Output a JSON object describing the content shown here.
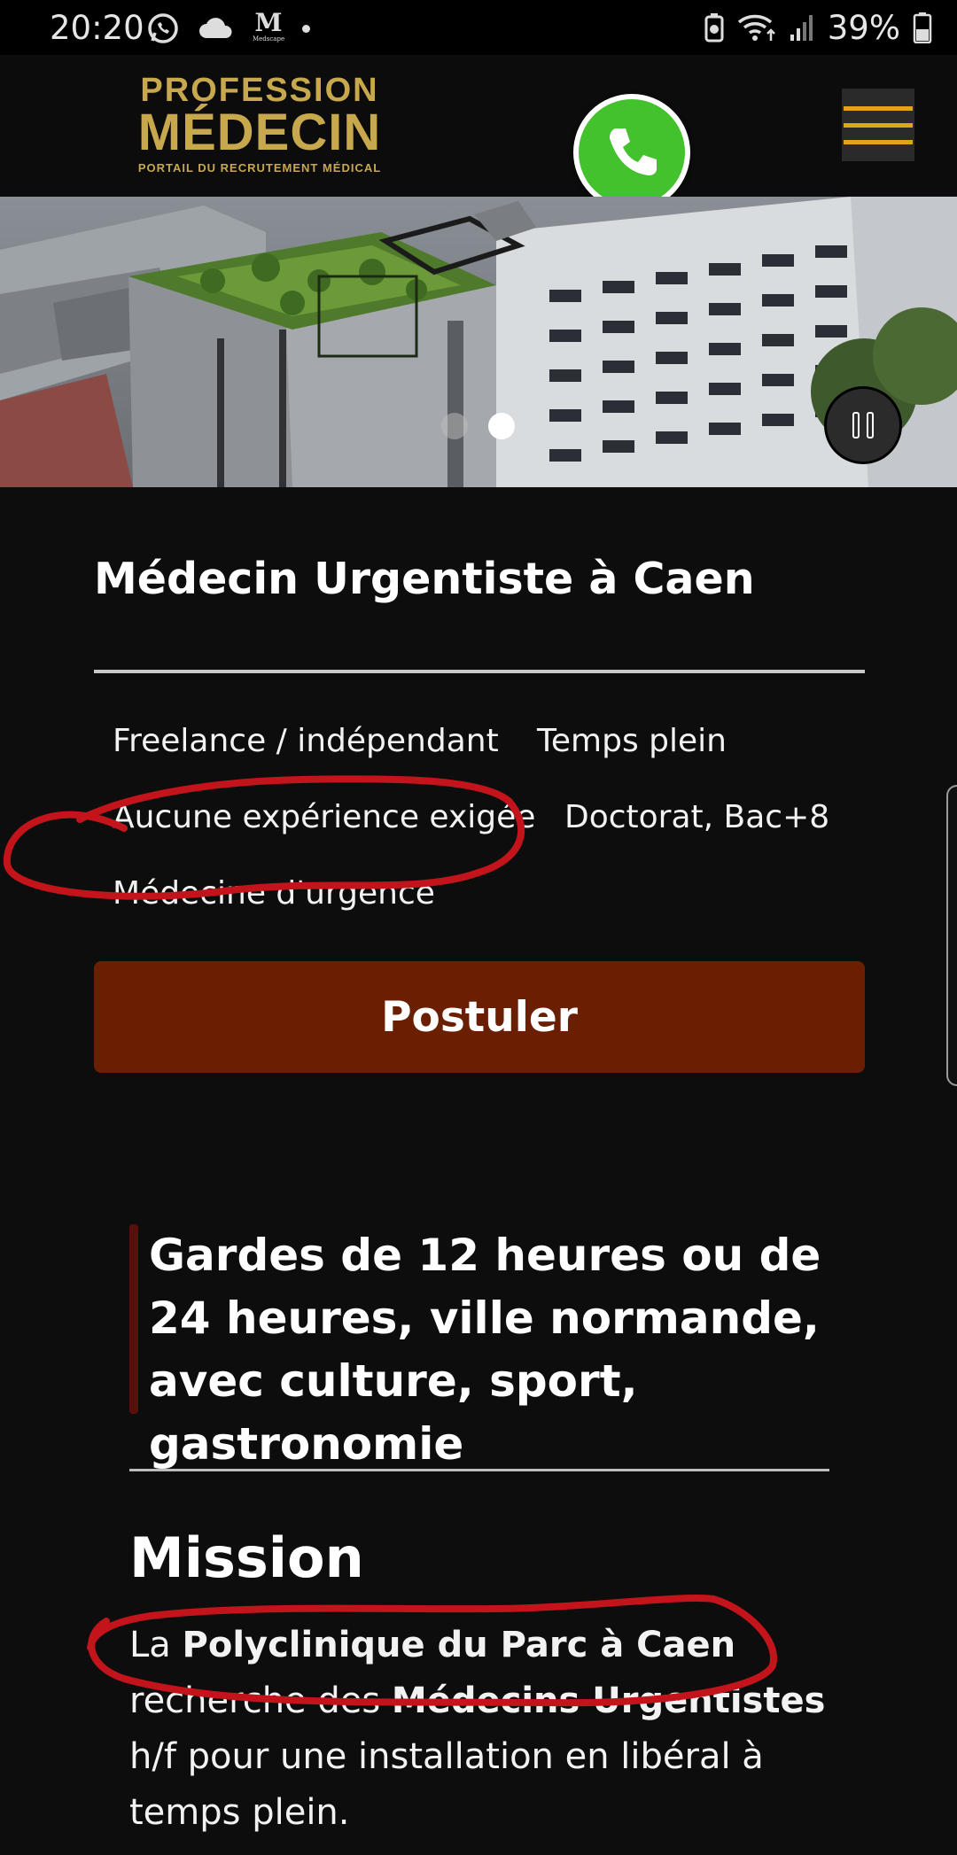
{
  "status_bar": {
    "time": "20:20",
    "battery": "39%",
    "left_icons": [
      "whatsapp-icon",
      "cloud-icon",
      "medscape-icon",
      "dot-icon"
    ],
    "right_icons": [
      "battery-saver-icon",
      "wifi-icon",
      "signal-icon",
      "battery-icon"
    ],
    "medscape_small": "Medscape"
  },
  "header": {
    "logo": {
      "line1": "PROFESSION",
      "line2": "MÉDECIN",
      "line3": "PORTAIL DU RECRUTEMENT MÉDICAL"
    },
    "call_icon": "phone-icon",
    "menu_icon": "hamburger-menu-icon"
  },
  "hero": {
    "slide_count": 2,
    "active_slide": 2,
    "control": "pause-icon"
  },
  "job": {
    "title": "Médecin Urgentiste à Caen",
    "tags": [
      "Freelance / indépendant",
      "Temps plein",
      "Aucune expérience exigée",
      "Doctorat, Bac+8",
      "Médecine d'urgence"
    ],
    "apply_label": "Postuler"
  },
  "quote": {
    "text": "Gardes de 12 heures ou de 24 heures, ville normande, avec culture, sport, gastronomie"
  },
  "mission": {
    "heading": "Mission",
    "p_la": "La ",
    "p_bold1": "Polyclinique du Parc à Caen",
    "p_mid": " recherche des ",
    "p_bold2": "Médecins Urgentistes",
    "p_end": " h/f pour une installation en libéral à temps plein."
  },
  "colors": {
    "background": "#0d0d0e",
    "logo_gold": "#c8a84d",
    "call_green": "#43c22e",
    "menu_orange": "#e2a517",
    "apply_button": "#6a1e02",
    "quote_bar": "#5a0f0a",
    "annotation_red": "#c4141b"
  }
}
